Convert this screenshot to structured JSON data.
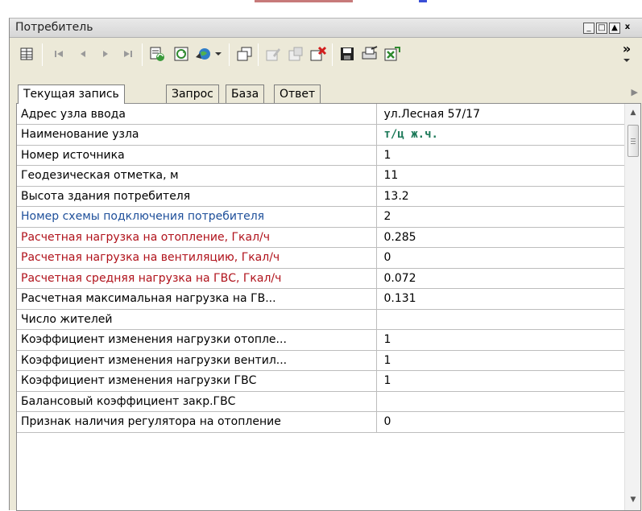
{
  "window": {
    "title": "Потребитель",
    "controls": [
      "_",
      "□",
      "▲",
      "x"
    ]
  },
  "toolbar": {
    "overflow": "»"
  },
  "tabs": [
    {
      "label": "Текущая запись",
      "active": true
    },
    {
      "label": "Запрос",
      "active": false
    },
    {
      "label": "База",
      "active": false
    },
    {
      "label": "Ответ",
      "active": false
    }
  ],
  "rows": [
    {
      "label": "Адрес узла ввода",
      "value": "ул.Лесная 57/17",
      "label_color": "black"
    },
    {
      "label": "Наименование узла",
      "value": "т/ц ж.ч.",
      "label_color": "black",
      "value_style": "green"
    },
    {
      "label": "Номер источника",
      "value": "1",
      "label_color": "black"
    },
    {
      "label": "Геодезическая отметка, м",
      "value": "11",
      "label_color": "black"
    },
    {
      "label": "Высота здания потребителя",
      "value": "13.2",
      "label_color": "black"
    },
    {
      "label": "Номер схемы подключения потребителя",
      "value": "2",
      "label_color": "blue"
    },
    {
      "label": "Расчетная нагрузка на отопление, Гкал/ч",
      "value": "0.285",
      "label_color": "red"
    },
    {
      "label": "Расчетная нагрузка на вентиляцию, Гкал/ч",
      "value": "0",
      "label_color": "red"
    },
    {
      "label": "Расчетная средняя нагрузка на ГВС, Гкал/ч",
      "value": "0.072",
      "label_color": "red"
    },
    {
      "label": "Расчетная максимальная нагрузка на ГВ...",
      "value": "0.131",
      "label_color": "black"
    },
    {
      "label": "Число жителей",
      "value": "",
      "label_color": "black"
    },
    {
      "label": "Коэффициент изменения нагрузки отопле...",
      "value": "1",
      "label_color": "black"
    },
    {
      "label": "Коэффициент изменения нагрузки вентил...",
      "value": "1",
      "label_color": "black"
    },
    {
      "label": "Коэффициент изменения нагрузки ГВС",
      "value": "1",
      "label_color": "black"
    },
    {
      "label": "Балансовый коэффициент закр.ГВС",
      "value": "",
      "label_color": "black"
    },
    {
      "label": "Признак наличия регулятора на отопление",
      "value": "0",
      "label_color": "black"
    }
  ],
  "colors": {
    "label_red": "#b0121b",
    "label_blue": "#1e4f9a",
    "value_green": "#1e7a5a"
  }
}
